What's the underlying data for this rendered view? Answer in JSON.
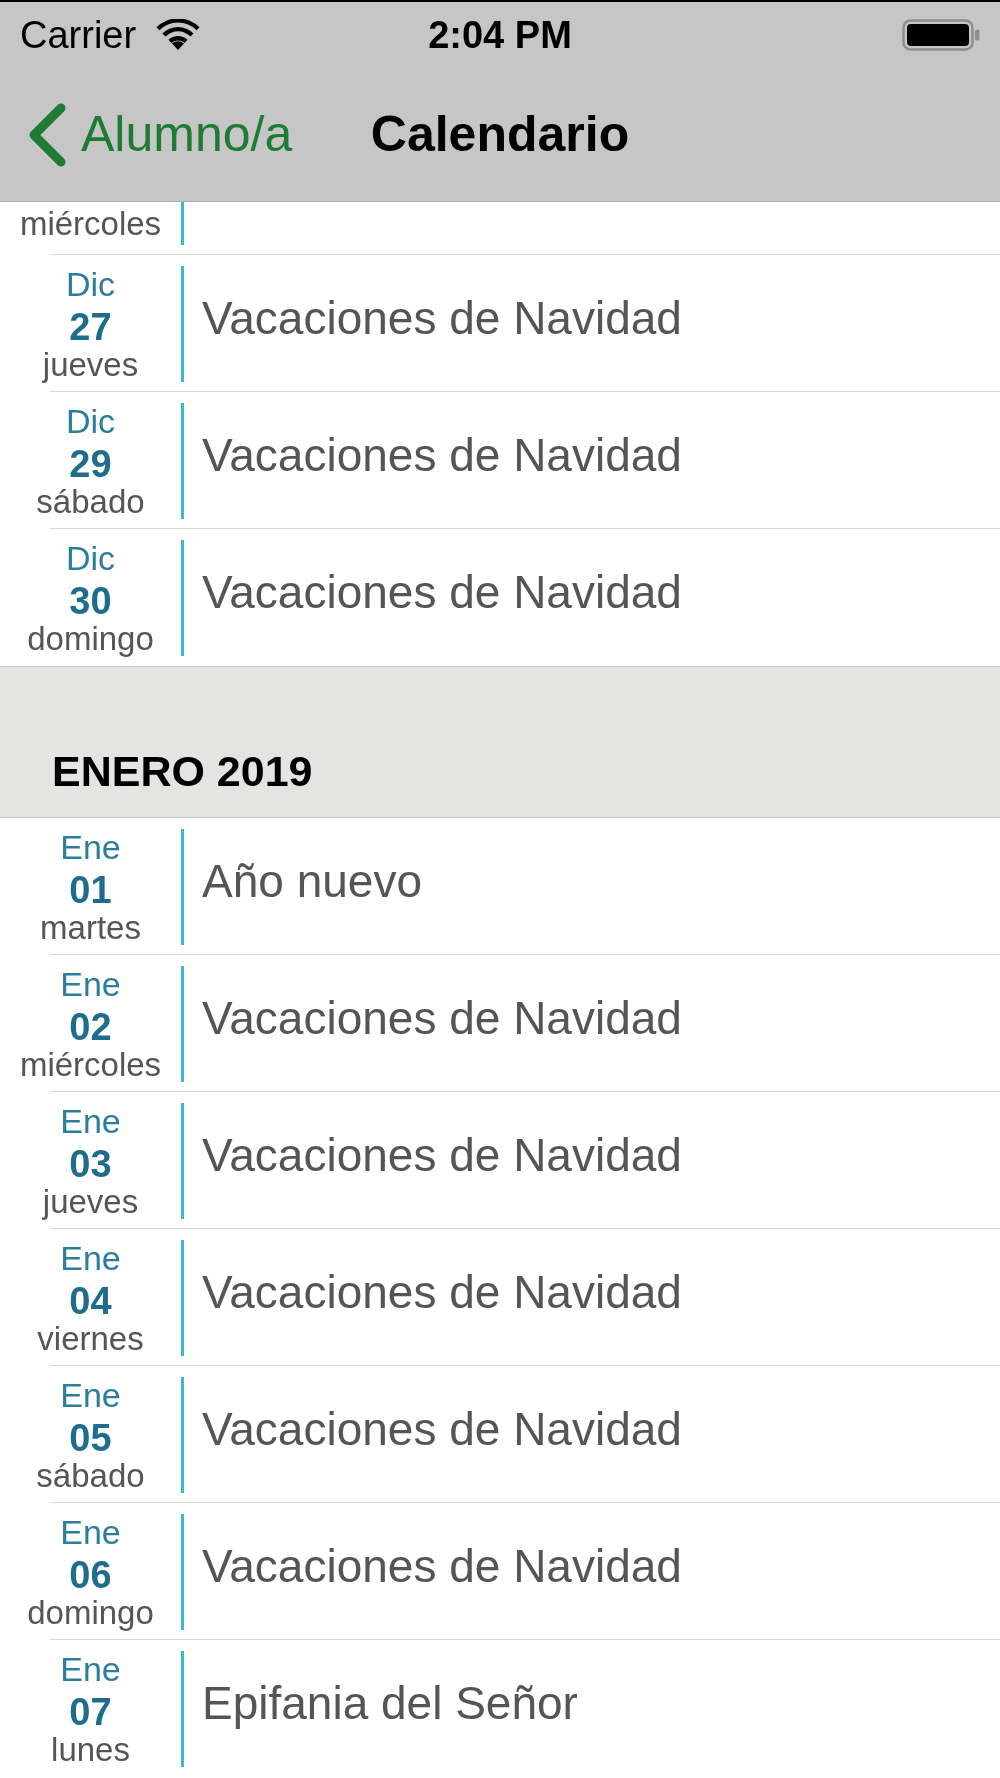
{
  "status_bar": {
    "carrier": "Carrier",
    "time": "2:04 PM"
  },
  "nav_bar": {
    "back": "Alumno/a",
    "title": "Calendario"
  },
  "cut_off_row": {
    "weekday": "miércoles"
  },
  "sections": [
    {
      "rows": [
        {
          "month": "Dic",
          "day": "27",
          "weekday": "jueves",
          "title": "Vacaciones de Navidad"
        },
        {
          "month": "Dic",
          "day": "29",
          "weekday": "sábado",
          "title": "Vacaciones de Navidad"
        },
        {
          "month": "Dic",
          "day": "30",
          "weekday": "domingo",
          "title": "Vacaciones de Navidad"
        }
      ]
    },
    {
      "header": "ENERO 2019",
      "rows": [
        {
          "month": "Ene",
          "day": "01",
          "weekday": "martes",
          "title": "Año nuevo"
        },
        {
          "month": "Ene",
          "day": "02",
          "weekday": "miércoles",
          "title": "Vacaciones de Navidad"
        },
        {
          "month": "Ene",
          "day": "03",
          "weekday": "jueves",
          "title": "Vacaciones de Navidad"
        },
        {
          "month": "Ene",
          "day": "04",
          "weekday": "viernes",
          "title": "Vacaciones de Navidad"
        },
        {
          "month": "Ene",
          "day": "05",
          "weekday": "sábado",
          "title": "Vacaciones de Navidad"
        },
        {
          "month": "Ene",
          "day": "06",
          "weekday": "domingo",
          "title": "Vacaciones de Navidad"
        },
        {
          "month": "Ene",
          "day": "07",
          "weekday": "lunes",
          "title": "Epifania del Señor"
        }
      ]
    }
  ]
}
